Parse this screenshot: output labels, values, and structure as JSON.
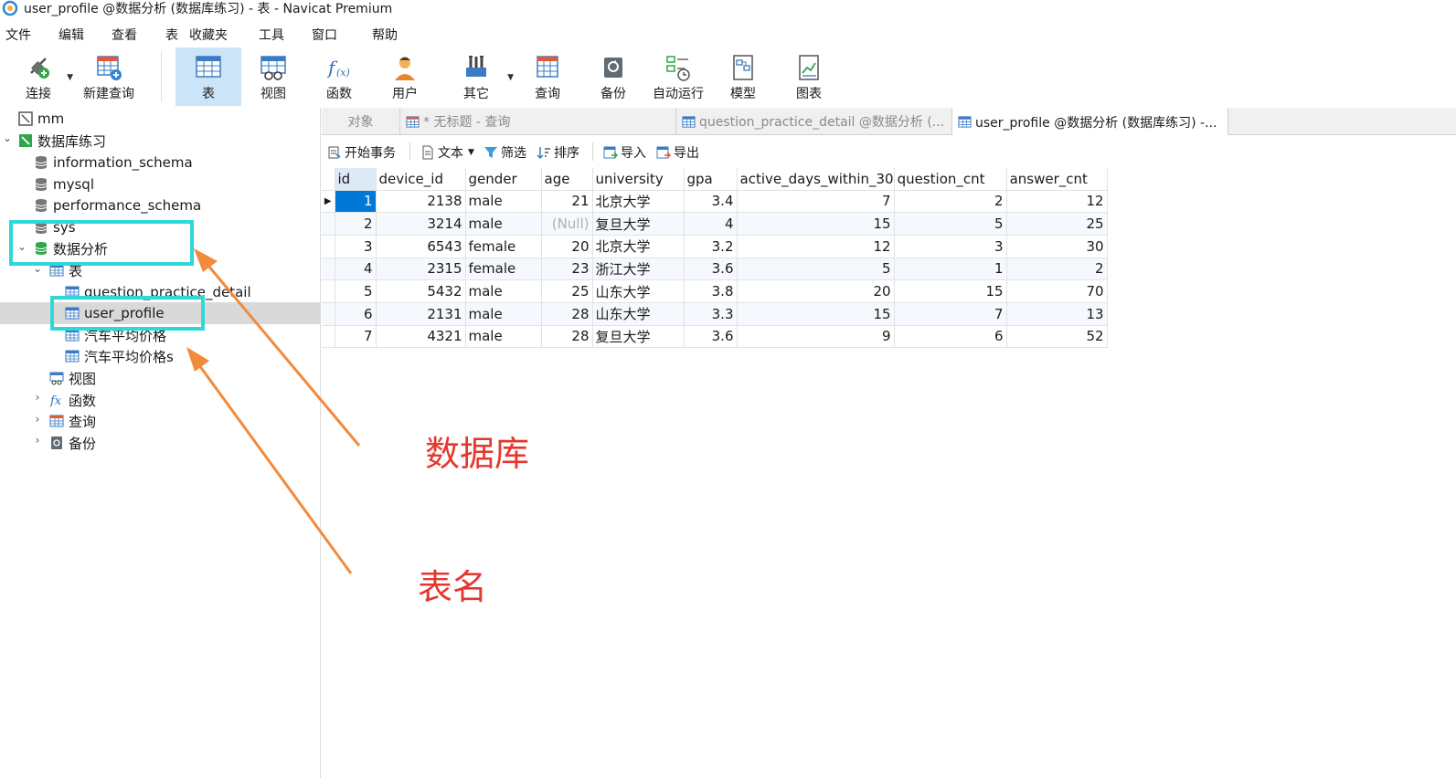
{
  "window": {
    "title": "user_profile @数据分析 (数据库练习) - 表 - Navicat Premium"
  },
  "menu": [
    "文件",
    "编辑",
    "查看",
    "表",
    "收藏夹",
    "工具",
    "窗口",
    "帮助"
  ],
  "toolbar": {
    "connect": "连接",
    "new_query": "新建查询",
    "table": "表",
    "view": "视图",
    "function": "函数",
    "user": "用户",
    "other": "其它",
    "query": "查询",
    "backup": "备份",
    "automation": "自动运行",
    "model": "模型",
    "chart": "图表"
  },
  "sidebar": {
    "conn_mm": "mm",
    "conn_practice": "数据库练习",
    "db_information_schema": "information_schema",
    "db_mysql": "mysql",
    "db_performance_schema": "performance_schema",
    "db_sys": "sys",
    "db_analysis": "数据分析",
    "group_tables": "表",
    "table_question_practice_detail": "question_practice_detail",
    "table_user_profile": "user_profile",
    "table_car_price": "汽车平均价格",
    "table_car_prices": "汽车平均价格s",
    "group_views": "视图",
    "group_functions": "函数",
    "group_queries": "查询",
    "group_backups": "备份"
  },
  "tabs": {
    "objects": "对象",
    "untitled_query": "* 无标题 - 查询",
    "question_practice_detail": "question_practice_detail @数据分析 (...",
    "user_profile": "user_profile @数据分析 (数据库练习) -..."
  },
  "subtoolbar": {
    "begin_transaction": "开始事务",
    "text": "文本",
    "filter": "筛选",
    "sort": "排序",
    "import": "导入",
    "export": "导出"
  },
  "grid": {
    "columns": [
      "id",
      "device_id",
      "gender",
      "age",
      "university",
      "gpa",
      "active_days_within_30",
      "question_cnt",
      "answer_cnt"
    ],
    "rows": [
      [
        "1",
        "2138",
        "male",
        "21",
        "北京大学",
        "3.4",
        "7",
        "2",
        "12"
      ],
      [
        "2",
        "3214",
        "male",
        "(Null)",
        "复旦大学",
        "4",
        "15",
        "5",
        "25"
      ],
      [
        "3",
        "6543",
        "female",
        "20",
        "北京大学",
        "3.2",
        "12",
        "3",
        "30"
      ],
      [
        "4",
        "2315",
        "female",
        "23",
        "浙江大学",
        "3.6",
        "5",
        "1",
        "2"
      ],
      [
        "5",
        "5432",
        "male",
        "25",
        "山东大学",
        "3.8",
        "20",
        "15",
        "70"
      ],
      [
        "6",
        "2131",
        "male",
        "28",
        "山东大学",
        "3.3",
        "15",
        "7",
        "13"
      ],
      [
        "7",
        "4321",
        "male",
        "28",
        "复旦大学",
        "3.6",
        "9",
        "6",
        "52"
      ]
    ]
  },
  "annotations": {
    "database_label": "数据库",
    "table_label": "表名",
    "highlight_color": "#2ed8d8",
    "arrow_color": "#f28a3c",
    "text_color": "#e5372f"
  }
}
